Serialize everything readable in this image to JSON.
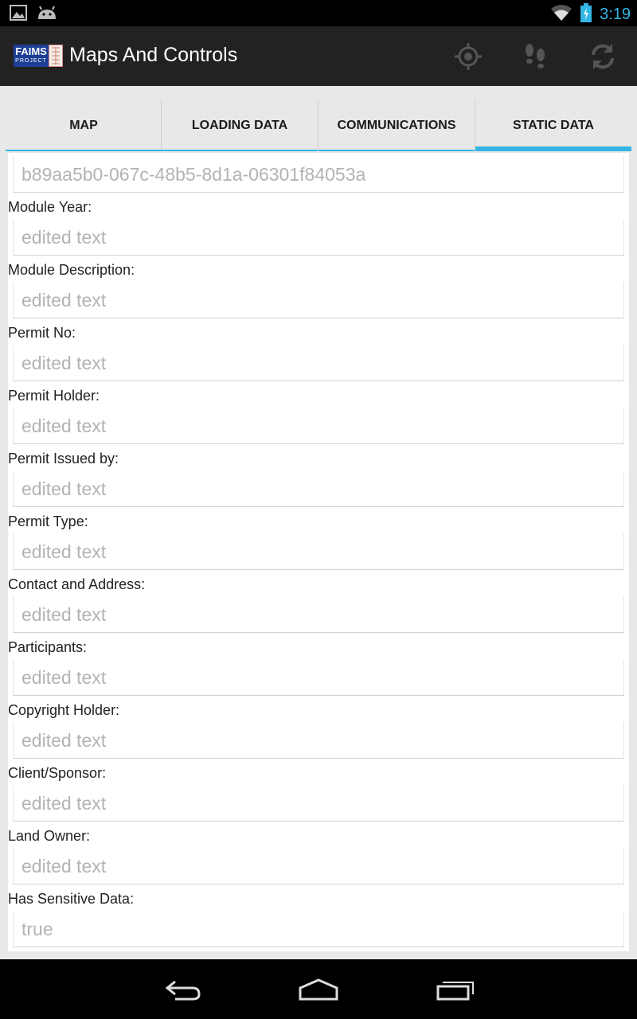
{
  "status_bar": {
    "time": "3:19",
    "icons": [
      "gallery-icon",
      "android-icon",
      "wifi-icon",
      "battery-charging-icon"
    ]
  },
  "action_bar": {
    "logo_text": "FAIMS",
    "logo_subtext": "PROJECT",
    "title": "Maps And Controls",
    "icons": [
      "gps-locate-icon",
      "footsteps-icon",
      "sync-icon"
    ]
  },
  "tabs": [
    {
      "label": "MAP",
      "selected": false
    },
    {
      "label": "LOADING DATA",
      "selected": false
    },
    {
      "label": "COMMUNICATIONS",
      "selected": false
    },
    {
      "label": "STATIC DATA",
      "selected": true
    }
  ],
  "accent_color": "#33b5e5",
  "uuid_field": {
    "value": "b89aa5b0-067c-48b5-8d1a-06301f84053a"
  },
  "fields": [
    {
      "label": "Module Year:",
      "value": "edited text"
    },
    {
      "label": "Module Description:",
      "value": "edited text"
    },
    {
      "label": "Permit No:",
      "value": "edited text"
    },
    {
      "label": "Permit Holder:",
      "value": "edited text"
    },
    {
      "label": "Permit Issued by:",
      "value": "edited text"
    },
    {
      "label": "Permit Type:",
      "value": "edited text"
    },
    {
      "label": "Contact and Address:",
      "value": "edited text"
    },
    {
      "label": "Participants:",
      "value": "edited text"
    },
    {
      "label": "Copyright Holder:",
      "value": "edited text"
    },
    {
      "label": "Client/Sponsor:",
      "value": "edited text"
    },
    {
      "label": "Land Owner:",
      "value": "edited text"
    },
    {
      "label": "Has Sensitive Data:",
      "value": "true"
    }
  ],
  "nav_bar": {
    "icons": [
      "back-icon",
      "home-icon",
      "recent-apps-icon"
    ]
  }
}
